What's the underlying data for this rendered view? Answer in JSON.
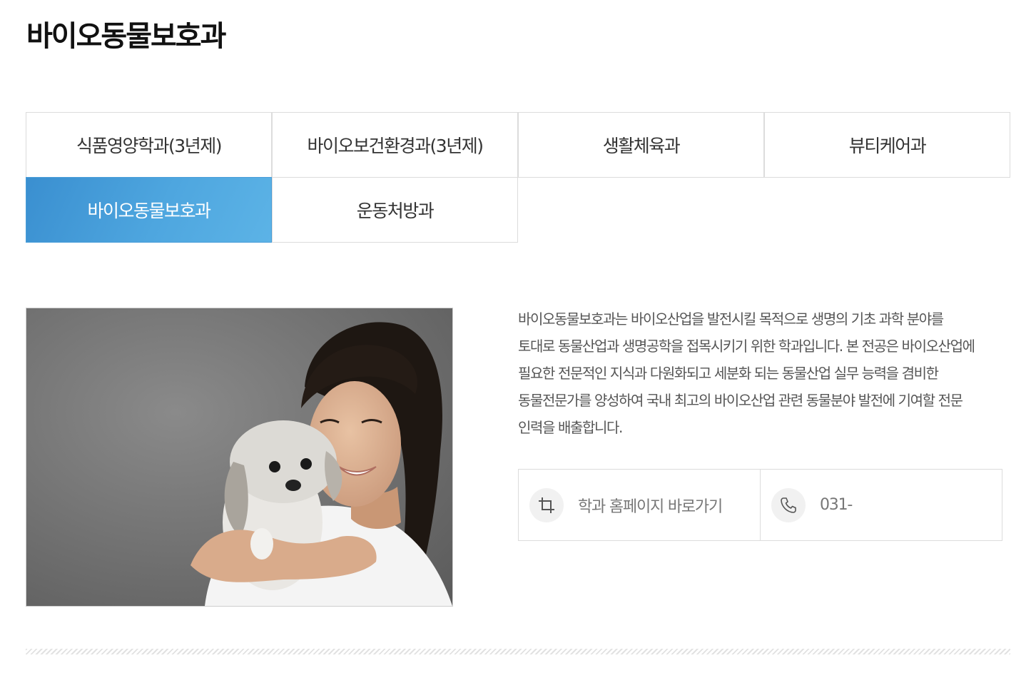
{
  "page": {
    "title": "바이오동물보호과"
  },
  "tabs": [
    {
      "label": "식품영양학과(3년제)",
      "active": false
    },
    {
      "label": "바이오보건환경과(3년제)",
      "active": false
    },
    {
      "label": "생활체육과",
      "active": false
    },
    {
      "label": "뷰티케어과",
      "active": false
    },
    {
      "label": "바이오동물보호과",
      "active": true
    },
    {
      "label": "운동처방과",
      "active": false
    }
  ],
  "description": {
    "lines": [
      "바이오동물보호과는 바이오산업을 발전시킬 목적으로 생명의 기초 과학 분야를",
      "토대로 동물산업과 생명공학을 접목시키기 위한 학과입니다. 본 전공은 바이오산업에",
      "필요한 전문적인 지식과 다원화되고 세분화 되는 동물산업 실무 능력을 겸비한",
      "동물전문가를 양성하여 국내 최고의 바이오산업 관련 동물분야 발전에 기여할 전문",
      "인력을 배출합니다."
    ]
  },
  "links": {
    "homepage": {
      "label": "학과 홈페이지 바로가기",
      "icon": "crop-icon"
    },
    "phone": {
      "label": "031-",
      "icon": "phone-icon"
    }
  },
  "colors": {
    "active_tab": "#4a9ed9",
    "border": "#dcdcdc"
  }
}
